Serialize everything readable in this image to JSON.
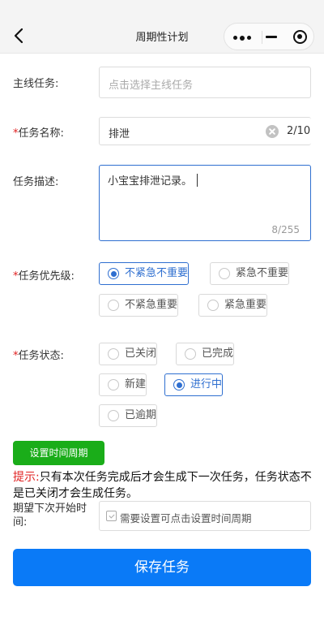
{
  "nav": {
    "title": "周期性计划"
  },
  "form": {
    "main_task": {
      "label": "主线任务:",
      "placeholder": "点击选择主线任务"
    },
    "task_name": {
      "required_mark": "*",
      "label": "任务名称:",
      "value": "排泄",
      "counter": "2/10"
    },
    "task_desc": {
      "label": "任务描述:",
      "value": "小宝宝排泄记录。",
      "counter": "8/255"
    },
    "priority": {
      "required_mark": "*",
      "label": "任务优先级:",
      "options": [
        "不紧急不重要",
        "紧急不重要",
        "不紧急重要",
        "紧急重要"
      ],
      "selected": "不紧急不重要"
    },
    "status": {
      "required_mark": "*",
      "label": "任务状态:",
      "options": [
        "已关闭",
        "已完成",
        "新建",
        "进行中",
        "已逾期"
      ],
      "selected": "进行中"
    }
  },
  "period_button": {
    "label": "设置时间周期"
  },
  "tip": {
    "label": "提示:",
    "text": "只有本次任务完成后才会生成下一次任务，任务状态不是已关闭才会生成任务。"
  },
  "expected_start": {
    "label": "期望下次开始时间:",
    "hint": "需要设置可点击设置时间周期"
  },
  "save": {
    "label": "保存任务"
  },
  "colors": {
    "accent": "#2f6fd0",
    "primary_button": "#0a7af7",
    "green_button": "#1aad19",
    "required": "#e02020"
  },
  "icons": {
    "back": "chevron-left-icon",
    "more": "more-dots-icon",
    "minimize": "minimize-icon",
    "close": "target-circle-icon",
    "clear": "clear-circle-icon",
    "calendar": "calendar-check-icon"
  }
}
